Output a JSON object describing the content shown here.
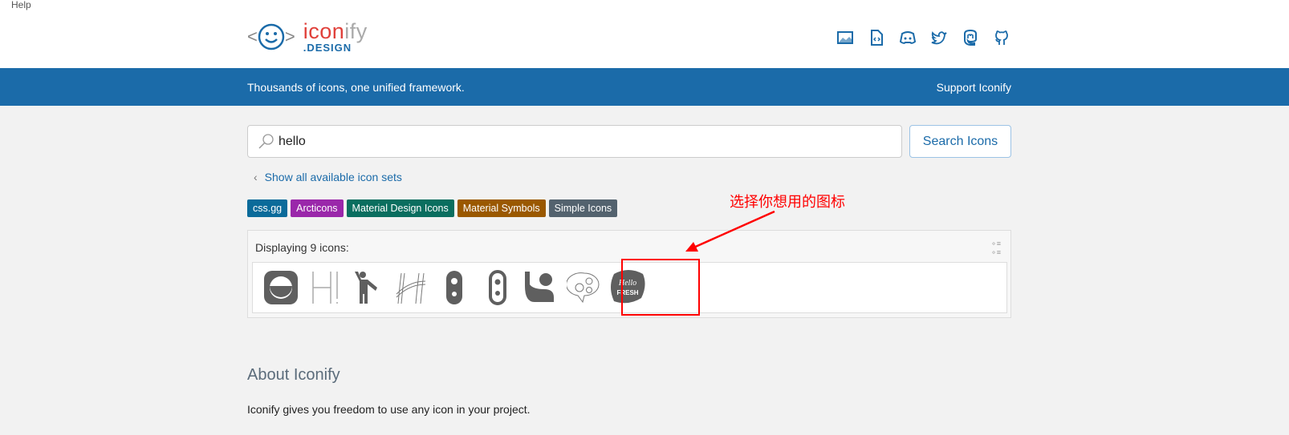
{
  "help": "Help",
  "logo": {
    "word1": "icon",
    "word2": "ify",
    "sub": ".DESIGN"
  },
  "header_icons": [
    "image-icon",
    "code-file-icon",
    "discord-icon",
    "twitter-icon",
    "mastodon-icon",
    "github-icon"
  ],
  "band": {
    "tagline": "Thousands of icons, one unified framework.",
    "support": "Support Iconify"
  },
  "search": {
    "value": "hello",
    "button": "Search Icons"
  },
  "back_link": "Show all available icon sets",
  "tags": [
    {
      "label": "css.gg",
      "color": "#0b6b9a"
    },
    {
      "label": "Arcticons",
      "color": "#9a27aa"
    },
    {
      "label": "Material Design Icons",
      "color": "#0a6e5f"
    },
    {
      "label": "Material Symbols",
      "color": "#9a5800"
    },
    {
      "label": "Simple Icons",
      "color": "#53626e"
    }
  ],
  "results": {
    "count_text": "Displaying 9 icons:",
    "icons": [
      "css-gg-hello",
      "arcticons-hello",
      "mdi-human-greeting",
      "arcticons-hello-2",
      "mdi-doorbell",
      "mdi-doorbell-outline",
      "material-symbols-waving-hand-person",
      "arcticons-hello-bubble",
      "simple-icons-hellofresh"
    ]
  },
  "annotation": "选择你想用的图标",
  "annotation_color": "#ff0000",
  "about": {
    "title": "About Iconify",
    "text": "Iconify gives you freedom to use any icon in your project."
  }
}
